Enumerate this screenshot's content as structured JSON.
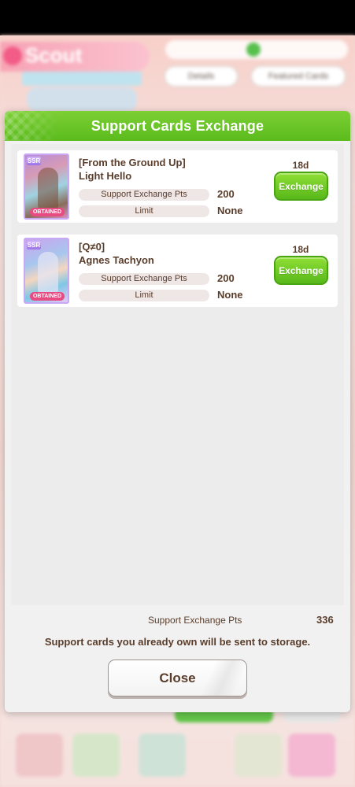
{
  "background": {
    "scout_label": "Scout",
    "details_label": "Details",
    "featured_label": "Featured Cards"
  },
  "modal": {
    "title": "Support Cards Exchange",
    "cards": [
      {
        "title_line1": "[From the Ground Up]",
        "title_line2": "Light Hello",
        "rarity": "SSR",
        "obtained_label": "OBTAINED",
        "pts_label": "Support Exchange Pts",
        "pts_value": "200",
        "limit_label": "Limit",
        "limit_value": "None",
        "time_left": "18d",
        "button_label": "Exchange"
      },
      {
        "title_line1": "[Q≠0]",
        "title_line2": "Agnes Tachyon",
        "rarity": "SSR",
        "obtained_label": "OBTAINED",
        "pts_label": "Support Exchange Pts",
        "pts_value": "200",
        "limit_label": "Limit",
        "limit_value": "None",
        "time_left": "18d",
        "button_label": "Exchange"
      }
    ],
    "footer": {
      "pts_label": "Support Exchange Pts",
      "pts_value": "336",
      "note": "Support cards you already own will be sent to storage.",
      "close_label": "Close"
    }
  },
  "colors": {
    "header_green": "#5bbb1d",
    "button_green": "#58b81a",
    "text_brown": "#5a3d2b",
    "obtained_pink": "#e84a82",
    "ssr_purple": "#9c72e6"
  }
}
